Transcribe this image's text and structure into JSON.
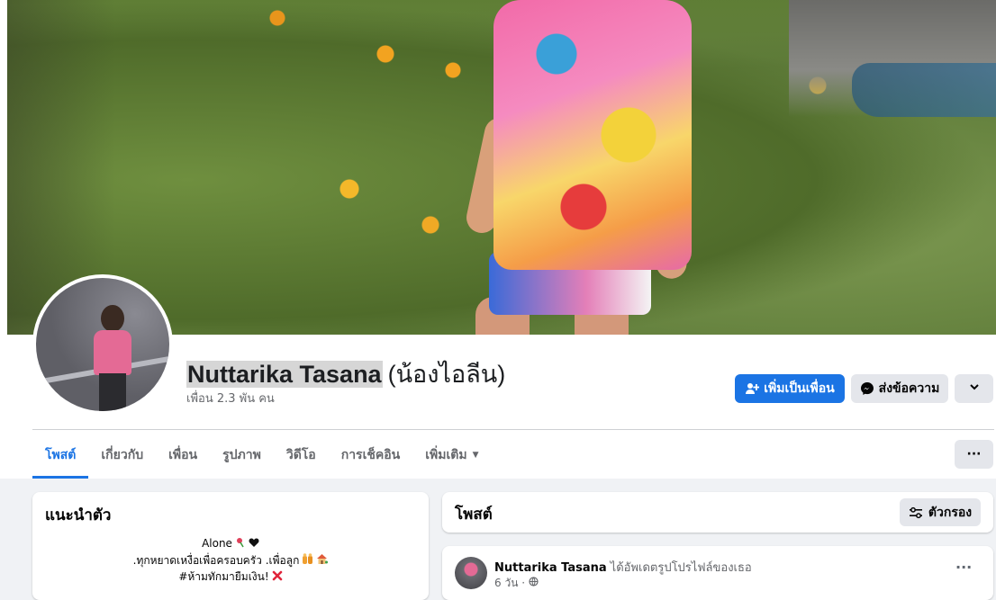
{
  "profile": {
    "name": "Nuttarika Tasana",
    "alternate_name": "(น้องไอลีน)",
    "friends": "เพื่อน 2.3 พัน คน"
  },
  "actions": {
    "add_friend": "เพิ่มเป็นเพื่อน",
    "message": "ส่งข้อความ",
    "more_icon": "chevron-down-icon"
  },
  "tabs": [
    {
      "label": "โพสต์",
      "active": true
    },
    {
      "label": "เกี่ยวกับ",
      "active": false
    },
    {
      "label": "เพื่อน",
      "active": false
    },
    {
      "label": "รูปภาพ",
      "active": false
    },
    {
      "label": "วิดีโอ",
      "active": false
    },
    {
      "label": "การเช็คอิน",
      "active": false
    },
    {
      "label": "เพิ่มเติม",
      "active": false
    }
  ],
  "tabs_more": "···",
  "intro": {
    "title": "แนะนำตัว",
    "bio_lines": [
      "Alone",
      ".ทุกหยาดเหงื่อเพื่อครอบครัว .เพื่อลูก",
      "#ห้ามทักมายืมเงิน!"
    ]
  },
  "posts": {
    "title": "โพสต์",
    "filter_label": "ตัวกรอง",
    "first_post": {
      "author": "Nuttarika Tasana",
      "action": "ได้อัพเดตรูปโปรไฟล์ของเธอ",
      "time": "6 วัน ·",
      "menu": "···"
    }
  },
  "colors": {
    "accent": "#1b74e4",
    "secondary_button": "#e4e6eb",
    "page_bg": "#f0f2f5"
  }
}
